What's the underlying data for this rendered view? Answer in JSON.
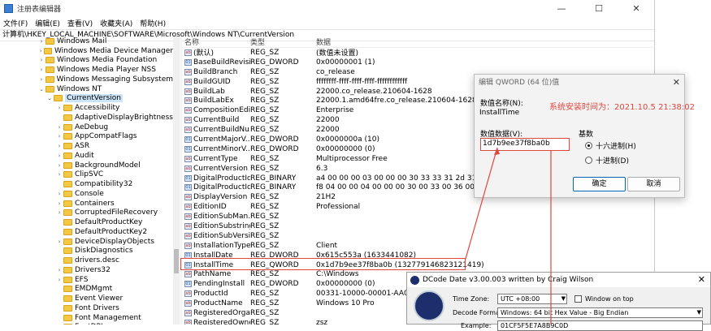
{
  "window": {
    "title": "注册表编辑器",
    "minimize": "—",
    "maximize": "☐",
    "close": "✕"
  },
  "menu": [
    "文件(F)",
    "编辑(E)",
    "查看(V)",
    "收藏夹(A)",
    "帮助(H)"
  ],
  "address": "计算机\\HKEY_LOCAL_MACHINE\\SOFTWARE\\Microsoft\\Windows NT\\CurrentVersion",
  "tree": [
    {
      "label": "Windows Mail",
      "level": 1,
      "arrow": "›",
      "selected": false
    },
    {
      "label": "Windows Media Device Manager",
      "level": 1,
      "arrow": "›",
      "selected": false
    },
    {
      "label": "Windows Media Foundation",
      "level": 1,
      "arrow": "›",
      "selected": false
    },
    {
      "label": "Windows Media Player NSS",
      "level": 1,
      "arrow": "›",
      "selected": false
    },
    {
      "label": "Windows Messaging Subsystem",
      "level": 1,
      "arrow": "›",
      "selected": false
    },
    {
      "label": "Windows NT",
      "level": 1,
      "arrow": "⌄",
      "selected": false
    },
    {
      "label": "CurrentVersion",
      "level": 2,
      "arrow": "⌄",
      "selected": true
    },
    {
      "label": "Accessibility",
      "level": 3,
      "arrow": "›",
      "selected": false
    },
    {
      "label": "AdaptiveDisplayBrightness",
      "level": 3,
      "arrow": "",
      "selected": false
    },
    {
      "label": "AeDebug",
      "level": 3,
      "arrow": "›",
      "selected": false
    },
    {
      "label": "AppCompatFlags",
      "level": 3,
      "arrow": "›",
      "selected": false
    },
    {
      "label": "ASR",
      "level": 3,
      "arrow": "›",
      "selected": false
    },
    {
      "label": "Audit",
      "level": 3,
      "arrow": "›",
      "selected": false
    },
    {
      "label": "BackgroundModel",
      "level": 3,
      "arrow": "›",
      "selected": false
    },
    {
      "label": "ClipSVC",
      "level": 3,
      "arrow": "›",
      "selected": false
    },
    {
      "label": "Compatibility32",
      "level": 3,
      "arrow": "",
      "selected": false
    },
    {
      "label": "Console",
      "level": 3,
      "arrow": "›",
      "selected": false
    },
    {
      "label": "Containers",
      "level": 3,
      "arrow": "›",
      "selected": false
    },
    {
      "label": "CorruptedFileRecovery",
      "level": 3,
      "arrow": "›",
      "selected": false
    },
    {
      "label": "DefaultProductKey",
      "level": 3,
      "arrow": "",
      "selected": false
    },
    {
      "label": "DefaultProductKey2",
      "level": 3,
      "arrow": "",
      "selected": false
    },
    {
      "label": "DeviceDisplayObjects",
      "level": 3,
      "arrow": "›",
      "selected": false
    },
    {
      "label": "DiskDiagnostics",
      "level": 3,
      "arrow": "",
      "selected": false
    },
    {
      "label": "drivers.desc",
      "level": 3,
      "arrow": "",
      "selected": false
    },
    {
      "label": "Drivers32",
      "level": 3,
      "arrow": "›",
      "selected": false
    },
    {
      "label": "EFS",
      "level": 3,
      "arrow": "›",
      "selected": false
    },
    {
      "label": "EMDMgmt",
      "level": 3,
      "arrow": "",
      "selected": false
    },
    {
      "label": "Event Viewer",
      "level": 3,
      "arrow": "",
      "selected": false
    },
    {
      "label": "Font Drivers",
      "level": 3,
      "arrow": "",
      "selected": false
    },
    {
      "label": "Font Management",
      "level": 3,
      "arrow": "",
      "selected": false
    },
    {
      "label": "FontDPI",
      "level": 3,
      "arrow": "",
      "selected": false
    }
  ],
  "list": {
    "headers": {
      "name": "名称",
      "type": "类型",
      "data": "数据"
    },
    "rows": [
      {
        "name": "(默认)",
        "type": "REG_SZ",
        "data": "(数值未设置)",
        "icon": "ab",
        "highlight": false
      },
      {
        "name": "BaseBuildRevisi...",
        "type": "REG_DWORD",
        "data": "0x00000001 (1)",
        "icon": "bin",
        "highlight": false
      },
      {
        "name": "BuildBranch",
        "type": "REG_SZ",
        "data": "co_release",
        "icon": "ab",
        "highlight": false
      },
      {
        "name": "BuildGUID",
        "type": "REG_SZ",
        "data": "ffffffff-ffff-ffff-ffff-ffffffffffff",
        "icon": "ab",
        "highlight": false
      },
      {
        "name": "BuildLab",
        "type": "REG_SZ",
        "data": "22000.co_release.210604-1628",
        "icon": "ab",
        "highlight": false
      },
      {
        "name": "BuildLabEx",
        "type": "REG_SZ",
        "data": "22000.1.amd64fre.co_release.210604-1628",
        "icon": "ab",
        "highlight": false
      },
      {
        "name": "CompositionEdi...",
        "type": "REG_SZ",
        "data": "Enterprise",
        "icon": "ab",
        "highlight": false
      },
      {
        "name": "CurrentBuild",
        "type": "REG_SZ",
        "data": "22000",
        "icon": "ab",
        "highlight": false
      },
      {
        "name": "CurrentBuildNu...",
        "type": "REG_SZ",
        "data": "22000",
        "icon": "ab",
        "highlight": false
      },
      {
        "name": "CurrentMajorV...",
        "type": "REG_DWORD",
        "data": "0x0000000a (10)",
        "icon": "bin",
        "highlight": false
      },
      {
        "name": "CurrentMinorV...",
        "type": "REG_DWORD",
        "data": "0x00000000 (0)",
        "icon": "bin",
        "highlight": false
      },
      {
        "name": "CurrentType",
        "type": "REG_SZ",
        "data": "Multiprocessor Free",
        "icon": "ab",
        "highlight": false
      },
      {
        "name": "CurrentVersion",
        "type": "REG_SZ",
        "data": "6.3",
        "icon": "ab",
        "highlight": false
      },
      {
        "name": "DigitalProductId",
        "type": "REG_BINARY",
        "data": "a4 00 00 00 03 00 00 00 30 33 33 31 2d 31 3...",
        "icon": "bin",
        "highlight": false
      },
      {
        "name": "DigitalProductId4",
        "type": "REG_BINARY",
        "data": "f8 04 00 00 04 00 00 00 30 00 33 00 36 00 31 0...",
        "icon": "bin",
        "highlight": false
      },
      {
        "name": "DisplayVersion",
        "type": "REG_SZ",
        "data": "21H2",
        "icon": "ab",
        "highlight": false
      },
      {
        "name": "EditionID",
        "type": "REG_SZ",
        "data": "Professional",
        "icon": "ab",
        "highlight": false
      },
      {
        "name": "EditionSubMan...",
        "type": "REG_SZ",
        "data": "",
        "icon": "ab",
        "highlight": false
      },
      {
        "name": "EditionSubstring",
        "type": "REG_SZ",
        "data": "",
        "icon": "ab",
        "highlight": false
      },
      {
        "name": "EditionSubVersi...",
        "type": "REG_SZ",
        "data": "",
        "icon": "ab",
        "highlight": false
      },
      {
        "name": "InstallationType",
        "type": "REG_SZ",
        "data": "Client",
        "icon": "ab",
        "highlight": false
      },
      {
        "name": "InstallDate",
        "type": "REG_DWORD",
        "data": "0x615c553a (1633441082)",
        "icon": "bin",
        "highlight": false
      },
      {
        "name": "InstallTime",
        "type": "REG_QWORD",
        "data": "0x1d7b9ee37f8ba0b (132779146823121419)",
        "icon": "bin",
        "highlight": true
      },
      {
        "name": "PathName",
        "type": "REG_SZ",
        "data": "C:\\Windows",
        "icon": "ab",
        "highlight": false
      },
      {
        "name": "PendingInstall",
        "type": "REG_DWORD",
        "data": "0x00000000 (0)",
        "icon": "bin",
        "highlight": false
      },
      {
        "name": "ProductId",
        "type": "REG_SZ",
        "data": "00331-10000-00001-AA099",
        "icon": "ab",
        "highlight": false
      },
      {
        "name": "ProductName",
        "type": "REG_SZ",
        "data": "Windows 10 Pro",
        "icon": "ab",
        "highlight": false
      },
      {
        "name": "RegisteredOrga...",
        "type": "REG_SZ",
        "data": "",
        "icon": "ab",
        "highlight": false
      },
      {
        "name": "RegisteredOwner",
        "type": "REG_SZ",
        "data": "zsz",
        "icon": "ab",
        "highlight": false
      }
    ]
  },
  "dialog": {
    "title": "编辑 QWORD (64 位)值",
    "close": "✕",
    "name_label": "数值名称(N):",
    "name_value": "InstallTime",
    "data_label": "数值数据(V):",
    "data_value": "1d7b9ee37f8ba0b",
    "base_label": "基数",
    "radio_hex": "十六进制(H)",
    "radio_dec": "十进制(D)",
    "ok": "确定",
    "cancel": "取消"
  },
  "annotation": "系统安装时间为：2021.10.5  21:38:02",
  "dcode": {
    "title": "DCode Date  v3.00.003  written by Craig Wilson",
    "close": "✕",
    "timezone_label": "Time Zone:",
    "timezone_value": "UTC +08:00",
    "window_on_top": "Window on top",
    "decode_label": "Decode Format:",
    "decode_value": "Windows: 64 bit Hex Value - Big Endian",
    "example_label": "Example:",
    "example_value": "01CF5F5E7A8B9C0D"
  },
  "colors": {
    "accent_red": "#e0463e",
    "selection": "#cce4f7",
    "folder": "#f5c842"
  }
}
